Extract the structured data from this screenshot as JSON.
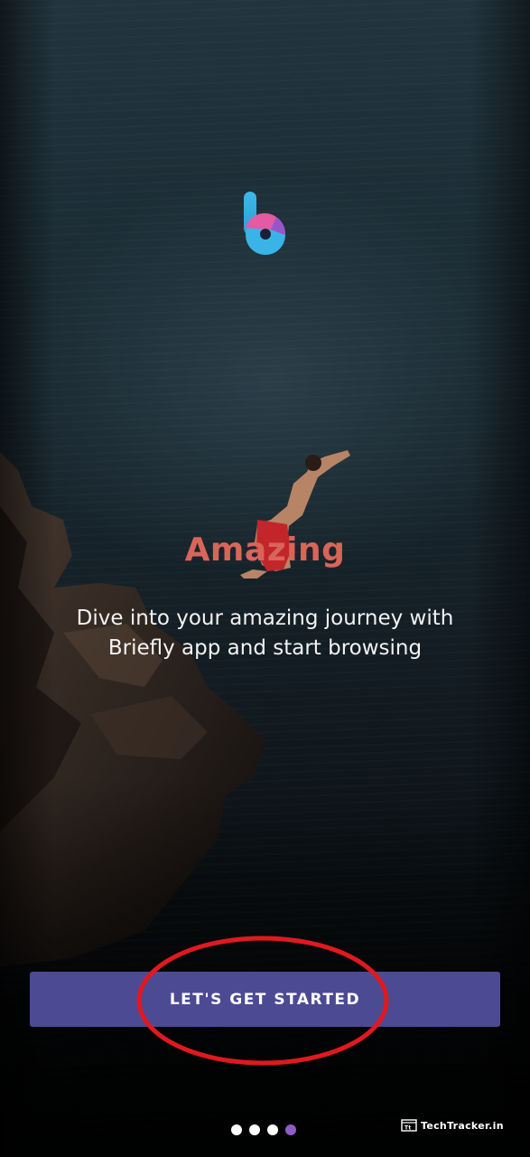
{
  "onboarding": {
    "logo_icon": "briefly-logo-icon",
    "title": "Amazing",
    "description": "Dive into your amazing journey with Briefly app and start browsing",
    "cta_label": "LET'S GET STARTED",
    "title_color": "#d9655a",
    "cta_color": "#4d4a94"
  },
  "pagination": {
    "total": 4,
    "active_index": 4,
    "active_color": "#8f5bc9"
  },
  "watermark": {
    "text": "TechTracker.in",
    "icon": "browser-window-icon"
  }
}
